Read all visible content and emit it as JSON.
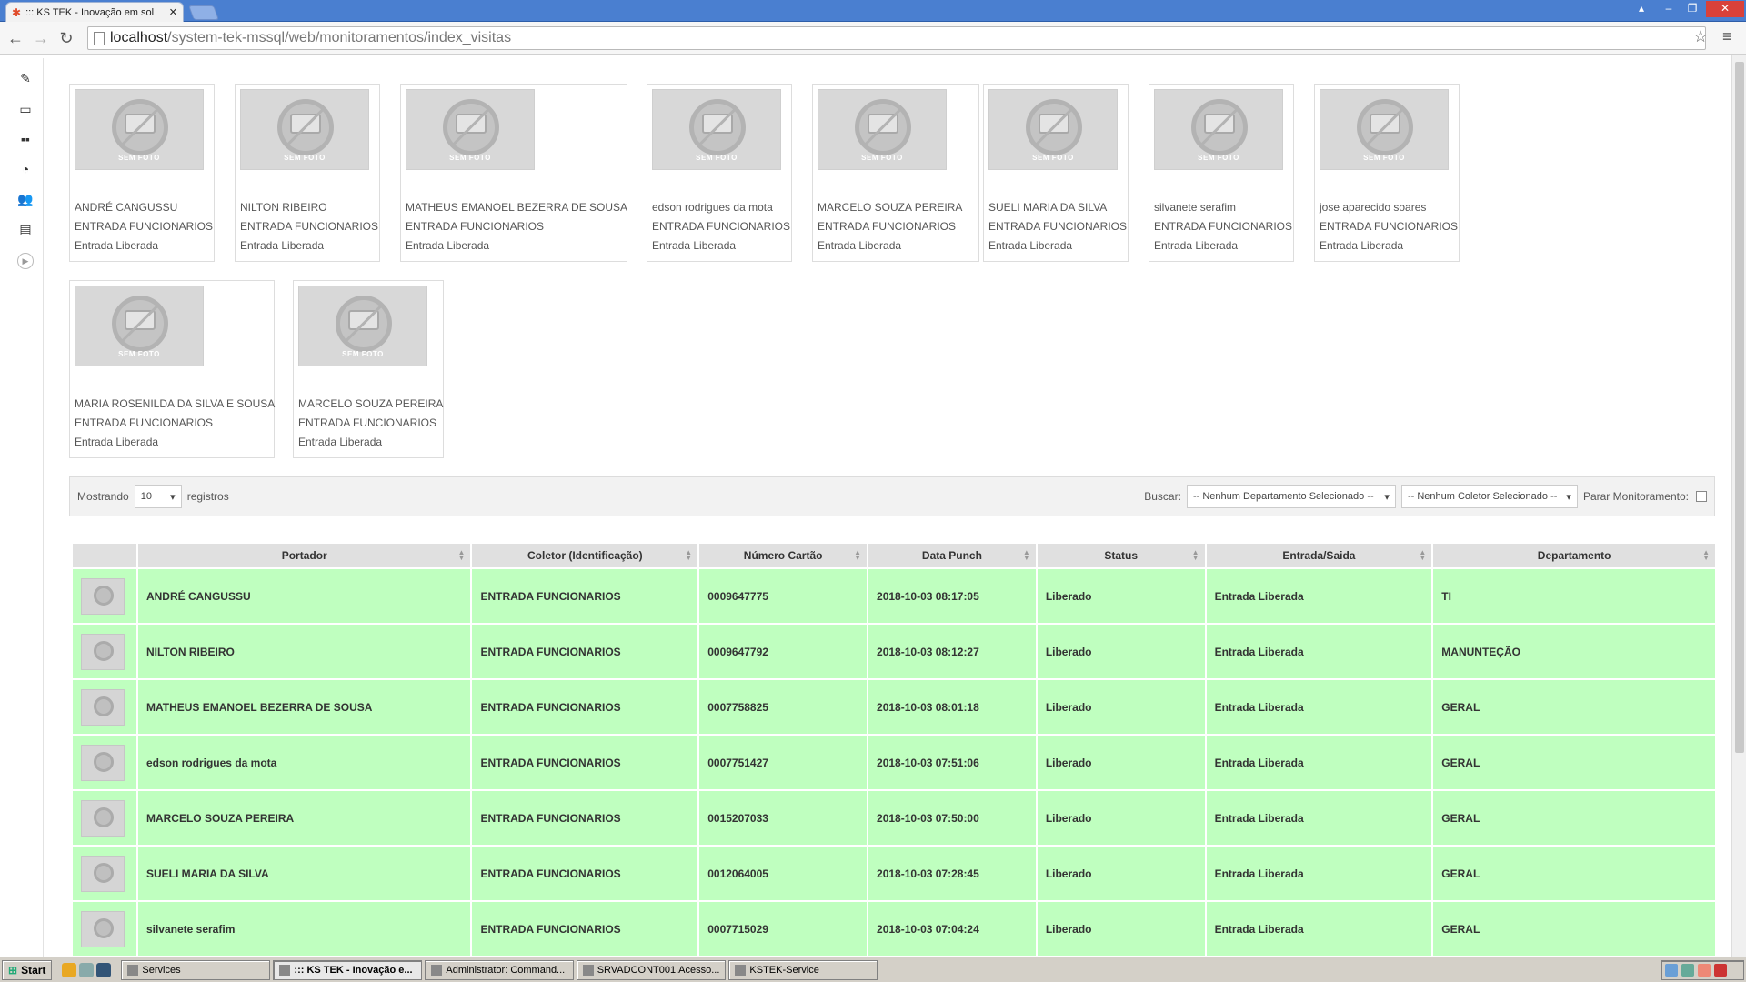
{
  "browser": {
    "tab_title": "::: KS TEK - Inovação em sol",
    "url_host": "localhost",
    "url_path": "/system-tek-mssql/web/monitoramentos/index_visitas"
  },
  "sidebar": {
    "icons": [
      "pencil-icon",
      "laptop-icon",
      "grid-icon",
      "pie-chart-icon",
      "users-icon",
      "gallery-icon",
      "arrow-right-icon"
    ]
  },
  "cards": [
    {
      "photo_label": "SEM FOTO",
      "name": "ANDRÉ CANGUSSU",
      "collector": "ENTRADA FUNCIONARIOS",
      "status": "Entrada Liberada"
    },
    {
      "photo_label": "SEM FOTO",
      "name": "NILTON RIBEIRO",
      "collector": "ENTRADA FUNCIONARIOS",
      "status": "Entrada Liberada"
    },
    {
      "photo_label": "SEM FOTO",
      "name": "MATHEUS EMANOEL BEZERRA DE SOUSA",
      "collector": "ENTRADA FUNCIONARIOS",
      "status": "Entrada Liberada"
    },
    {
      "photo_label": "SEM FOTO",
      "name": "edson rodrigues da mota",
      "collector": "ENTRADA FUNCIONARIOS",
      "status": "Entrada Liberada"
    },
    {
      "photo_label": "SEM FOTO",
      "name": "MARCELO SOUZA PEREIRA",
      "collector": "ENTRADA FUNCIONARIOS",
      "status": "Entrada Liberada"
    },
    {
      "photo_label": "SEM FOTO",
      "name": "SUELI MARIA DA SILVA",
      "collector": "ENTRADA FUNCIONARIOS",
      "status": "Entrada Liberada"
    },
    {
      "photo_label": "SEM FOTO",
      "name": "silvanete serafim",
      "collector": "ENTRADA FUNCIONARIOS",
      "status": "Entrada Liberada"
    },
    {
      "photo_label": "SEM FOTO",
      "name": "jose aparecido soares",
      "collector": "ENTRADA FUNCIONARIOS",
      "status": "Entrada Liberada"
    },
    {
      "photo_label": "SEM FOTO",
      "name": "MARIA ROSENILDA DA SILVA E SOUSA",
      "collector": "ENTRADA FUNCIONARIOS",
      "status": "Entrada Liberada"
    },
    {
      "photo_label": "SEM FOTO",
      "name": "MARCELO SOUZA PEREIRA",
      "collector": "ENTRADA FUNCIONARIOS",
      "status": "Entrada Liberada"
    }
  ],
  "controls": {
    "showing_label": "Mostrando",
    "page_size": "10",
    "records_label": "registros",
    "search_label": "Buscar:",
    "department_select": "-- Nenhum Departamento Selecionado --",
    "collector_select": "-- Nenhum Coletor Selecionado --",
    "stop_label": "Parar Monitoramento:"
  },
  "table": {
    "headers": [
      "",
      "Portador",
      "Coletor (Identificação)",
      "Número Cartão",
      "Data Punch",
      "Status",
      "Entrada/Saida",
      "Departamento"
    ],
    "rows": [
      [
        "ANDRÉ CANGUSSU",
        "ENTRADA FUNCIONARIOS",
        "0009647775",
        "2018-10-03 08:17:05",
        "Liberado",
        "Entrada Liberada",
        "TI"
      ],
      [
        "NILTON RIBEIRO",
        "ENTRADA FUNCIONARIOS",
        "0009647792",
        "2018-10-03 08:12:27",
        "Liberado",
        "Entrada Liberada",
        "MANUNTEÇÃO"
      ],
      [
        "MATHEUS EMANOEL BEZERRA DE SOUSA",
        "ENTRADA FUNCIONARIOS",
        "0007758825",
        "2018-10-03 08:01:18",
        "Liberado",
        "Entrada Liberada",
        "GERAL"
      ],
      [
        "edson rodrigues da mota",
        "ENTRADA FUNCIONARIOS",
        "0007751427",
        "2018-10-03 07:51:06",
        "Liberado",
        "Entrada Liberada",
        "GERAL"
      ],
      [
        "MARCELO SOUZA PEREIRA",
        "ENTRADA FUNCIONARIOS",
        "0015207033",
        "2018-10-03 07:50:00",
        "Liberado",
        "Entrada Liberada",
        "GERAL"
      ],
      [
        "SUELI MARIA DA SILVA",
        "ENTRADA FUNCIONARIOS",
        "0012064005",
        "2018-10-03 07:28:45",
        "Liberado",
        "Entrada Liberada",
        "GERAL"
      ],
      [
        "silvanete serafim",
        "ENTRADA FUNCIONARIOS",
        "0007715029",
        "2018-10-03 07:04:24",
        "Liberado",
        "Entrada Liberada",
        "GERAL"
      ]
    ]
  },
  "taskbar": {
    "start": "Start",
    "items": [
      "Services",
      "::: KS TEK - Inovação e...",
      "Administrator: Command...",
      "SRVADCONT001.Acesso...",
      "KSTEK-Service"
    ]
  },
  "colors": {
    "row_ok": "#bfffbf",
    "titlebar": "#4a7fd0",
    "header_bg": "#e0e0e0"
  }
}
